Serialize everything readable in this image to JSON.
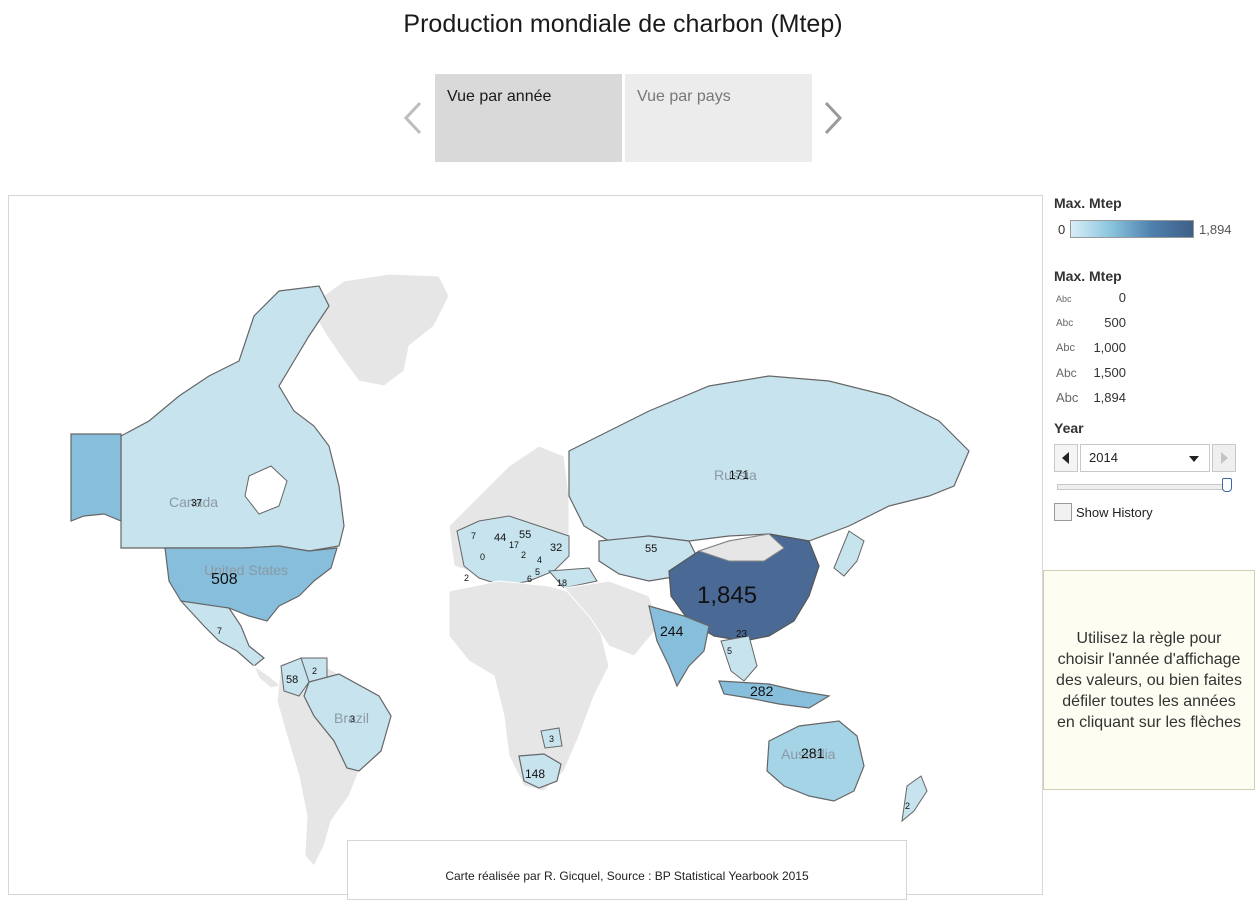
{
  "title": "Production mondiale de charbon (Mtep)",
  "tabs": [
    {
      "label": "Vue par année",
      "active": true
    },
    {
      "label": "Vue par pays",
      "active": false
    }
  ],
  "colors": {
    "low": "#d8eef7",
    "mid": "#88c3dc",
    "high": "#3e5f88",
    "no_data": "#e6e6e6"
  },
  "map": {
    "country_names": [
      {
        "name": "Canada"
      },
      {
        "name": "United States"
      },
      {
        "name": "Russia"
      },
      {
        "name": "Brazil"
      },
      {
        "name": "Australia"
      }
    ],
    "values": [
      {
        "country": "China",
        "value": "1,845"
      },
      {
        "country": "United States",
        "value": "508"
      },
      {
        "country": "Indonesia",
        "value": "282"
      },
      {
        "country": "Australia",
        "value": "281"
      },
      {
        "country": "India",
        "value": "244"
      },
      {
        "country": "Russia",
        "value": "171"
      },
      {
        "country": "South Africa",
        "value": "148"
      },
      {
        "country": "Colombia",
        "value": "58"
      },
      {
        "country": "Kazakhstan",
        "value": "55"
      },
      {
        "country": "Poland",
        "value": "55"
      },
      {
        "country": "Germany",
        "value": "44"
      },
      {
        "country": "Canada",
        "value": "37"
      },
      {
        "country": "Ukraine",
        "value": "32"
      },
      {
        "country": "Vietnam",
        "value": "23"
      },
      {
        "country": "Turkey",
        "value": "18"
      },
      {
        "country": "Czech Republic",
        "value": "17"
      },
      {
        "country": "United Kingdom",
        "value": "7"
      },
      {
        "country": "Mexico",
        "value": "7"
      },
      {
        "country": "Thailand",
        "value": "5"
      },
      {
        "country": "Serbia",
        "value": "5"
      },
      {
        "country": "Romania",
        "value": "4"
      },
      {
        "country": "Brazil",
        "value": "3"
      },
      {
        "country": "Zimbabwe",
        "value": "3"
      },
      {
        "country": "Venezuela",
        "value": "2"
      },
      {
        "country": "Spain",
        "value": "2"
      },
      {
        "country": "Hungary",
        "value": "2"
      },
      {
        "country": "New Zealand",
        "value": "2"
      },
      {
        "country": "Greece",
        "value": "6"
      },
      {
        "country": "France",
        "value": "0"
      }
    ]
  },
  "credit": "Carte réalisée par R. Gicquel,    Source : BP Statistical Yearbook 2015",
  "legend": {
    "color_title": "Max. Mtep",
    "color_min": "0",
    "color_max": "1,894",
    "size_title": "Max. Mtep",
    "abc": "Abc",
    "sizes": [
      "0",
      "500",
      "1,000",
      "1,500",
      "1,894"
    ]
  },
  "year_filter": {
    "label": "Year",
    "selected": "2014",
    "prev_icon": "chevron-left-icon",
    "next_icon": "chevron-right-icon",
    "slider_position_fraction": 1.0
  },
  "show_history": {
    "label": "Show History",
    "checked": false
  },
  "help_text": "Utilisez la règle pour choisir l'année d'affichage des valeurs, ou bien faites défiler toutes les années en cliquant sur les flèches"
}
